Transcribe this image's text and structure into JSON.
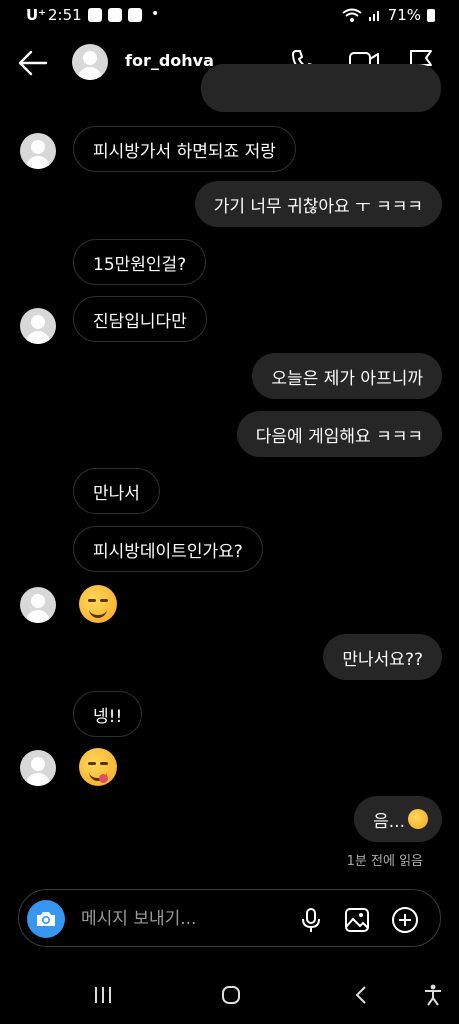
{
  "status_bar": {
    "carrier": "U⁺",
    "time": "2:51",
    "dot": "•",
    "battery": "71%"
  },
  "header": {
    "username": "for_dohva",
    "icons": [
      "back-arrow-icon",
      "phone-icon",
      "video-camera-icon",
      "flag-icon"
    ]
  },
  "messages": [
    {
      "side": "in",
      "text": "피시방가서 하면되죠 저랑",
      "avatar": true
    },
    {
      "side": "out",
      "text": "가기 너무 귀찮아요 ㅜ ㅋㅋㅋ"
    },
    {
      "side": "in",
      "text": "15만원인걸?",
      "avatar": false
    },
    {
      "side": "in",
      "text": "진담입니다만",
      "avatar": true
    },
    {
      "side": "out",
      "text": "오늘은 제가 아프니까"
    },
    {
      "side": "out",
      "text": "다음에 게임해요 ㅋㅋㅋ"
    },
    {
      "side": "in",
      "text": "만나서",
      "avatar": false
    },
    {
      "side": "in",
      "text": "피시방데이트인가요?",
      "avatar": false
    },
    {
      "side": "in",
      "emoji": "smiling-face-icon",
      "avatar": true
    },
    {
      "side": "out",
      "text": "만나서요??"
    },
    {
      "side": "in",
      "text": "넹!!",
      "avatar": false
    },
    {
      "side": "in",
      "emoji": "yum-face-icon",
      "avatar": true
    },
    {
      "side": "out",
      "text": "음...",
      "emoji": "thinking-face-icon"
    }
  ],
  "read_receipt": "1분 전에 읽음",
  "composer": {
    "placeholder": "메시지 보내기...",
    "icons": [
      "camera-icon",
      "microphone-icon",
      "gallery-icon",
      "plus-circle-icon"
    ]
  },
  "colors": {
    "accent": "#3797f0",
    "outgoing_bubble": "#262626",
    "incoming_border": "#2e2e2e"
  }
}
